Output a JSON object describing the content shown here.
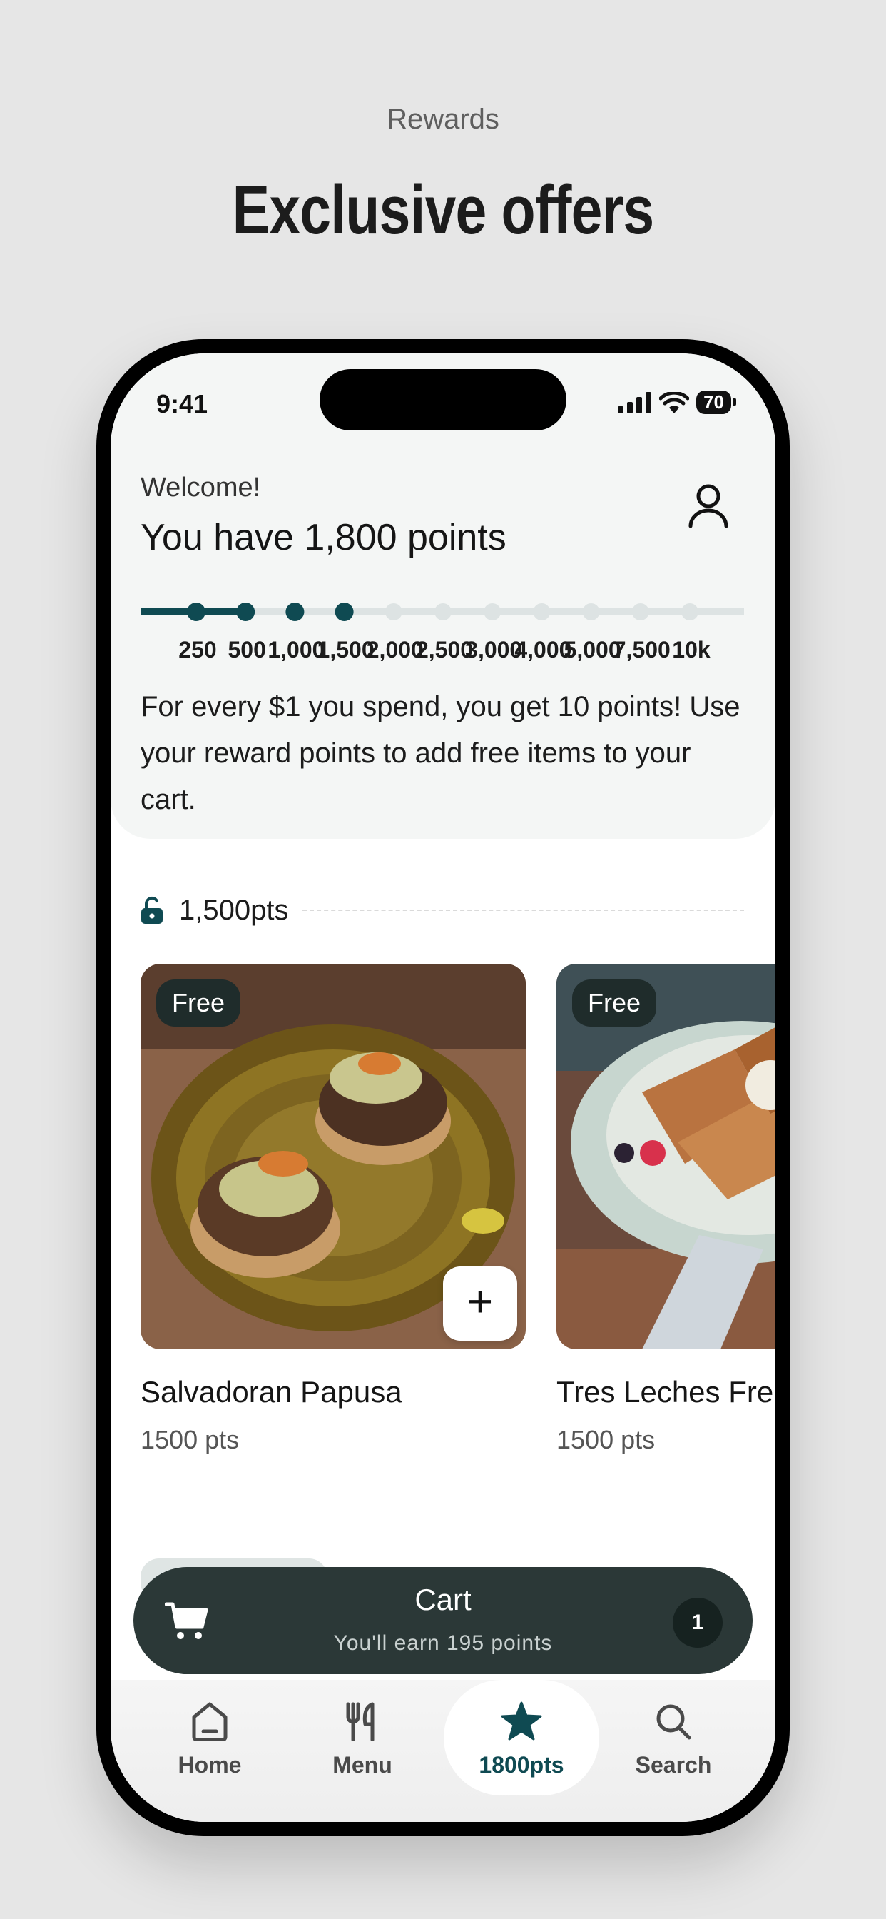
{
  "header": {
    "subtitle": "Rewards",
    "title": "Exclusive offers"
  },
  "status_bar": {
    "time": "9:41",
    "battery": "70"
  },
  "rewards": {
    "welcome": "Welcome!",
    "points_title": "You have 1,800 points",
    "current_points": 1800,
    "progress_fraction": 0.17,
    "milestones": [
      "250",
      "500",
      "1,000",
      "1,500",
      "2,000",
      "2,500",
      "3,000",
      "4,000",
      "5,000",
      "7,500",
      "10k"
    ],
    "achieved_milestones": 4,
    "description": "For every $1 you spend, you get 10 points! Use your reward points to add free items to your cart."
  },
  "tier": {
    "label": "1,500pts",
    "icon": "unlock-icon"
  },
  "items": [
    {
      "badge": "Free",
      "name": "Salvadoran Papusa",
      "points": "1500 pts"
    },
    {
      "badge": "Free",
      "name": "Tres Leches French Toast",
      "points": "1500 pts"
    }
  ],
  "cart": {
    "title": "Cart",
    "subtitle": "You'll earn 195 points",
    "count": "1"
  },
  "tabs": [
    {
      "label": "Home",
      "icon": "home-icon"
    },
    {
      "label": "Menu",
      "icon": "utensils-icon"
    },
    {
      "label": "1800pts",
      "icon": "star-icon"
    },
    {
      "label": "Search",
      "icon": "search-icon"
    }
  ],
  "colors": {
    "accent": "#0f4a52",
    "track": "#dde3e3",
    "cart_bg": "#2b3837",
    "badge_bg": "#1f2c2b"
  }
}
